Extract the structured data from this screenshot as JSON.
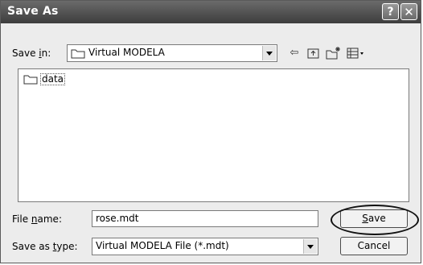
{
  "window": {
    "title": "Save As",
    "help_button": "?",
    "close_button": "✕"
  },
  "toolbar": {
    "save_in_label_pre": "Save ",
    "save_in_label_accel": "i",
    "save_in_label_post": "n:",
    "current_folder": "Virtual MODELA",
    "icons": [
      "back-icon",
      "up-folder-icon",
      "new-folder-icon",
      "view-menu-icon"
    ]
  },
  "file_list": {
    "items": [
      {
        "name": "data",
        "icon": "folder-icon"
      }
    ]
  },
  "form": {
    "file_name_label_pre": "File ",
    "file_name_label_accel": "n",
    "file_name_label_post": "ame:",
    "file_name_value": "rose.mdt",
    "save_type_label_pre": "Save as ",
    "save_type_label_accel": "t",
    "save_type_label_post": "ype:",
    "save_type_value": "Virtual MODELA File (*.mdt)"
  },
  "buttons": {
    "save_accel": "S",
    "save_rest": "ave",
    "cancel": "Cancel"
  }
}
